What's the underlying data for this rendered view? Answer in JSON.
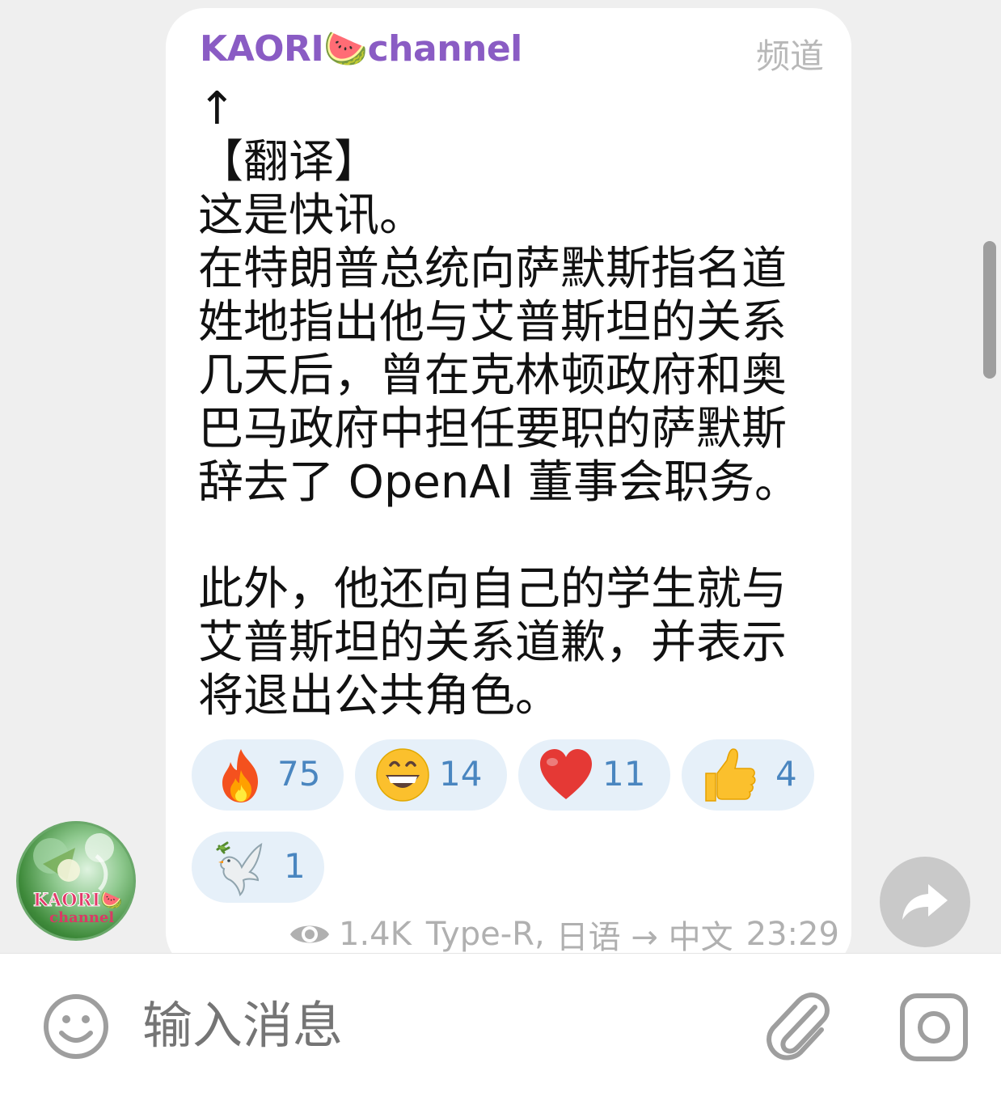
{
  "message": {
    "channel_name": "KAORI🍉channel",
    "channel_tag": "频道",
    "text": "↑\n【翻译】\n这是快讯。\n在特朗普总统向萨默斯指名道\n姓地指出他与艾普斯坦的关系\n几天后，曾在克林顿政府和奥\n巴马政府中担任要职的萨默斯\n辞去了 OpenAI 董事会职务。\n\n此外，他还向自己的学生就与\n艾普斯坦的关系道歉，并表示\n将退出公共角色。",
    "reactions": [
      {
        "emoji": "fire-emoji",
        "count": "75"
      },
      {
        "emoji": "grinning-face-emoji",
        "count": "14"
      },
      {
        "emoji": "red-heart-emoji",
        "count": "11"
      },
      {
        "emoji": "thumbs-up-emoji",
        "count": "4"
      },
      {
        "emoji": "dove-emoji",
        "count": "1"
      }
    ],
    "views": "1.4K",
    "author": "Type-R,",
    "translation": "日语 → 中文",
    "time": "23:29"
  },
  "avatar": {
    "label_line1": "KAORI🍉",
    "label_line2": "channel"
  },
  "input": {
    "placeholder": "输入消息"
  },
  "colors": {
    "channel_name": "#8a5cc4",
    "reaction_bg": "#e6f0f9",
    "reaction_count": "#4a86c0"
  }
}
